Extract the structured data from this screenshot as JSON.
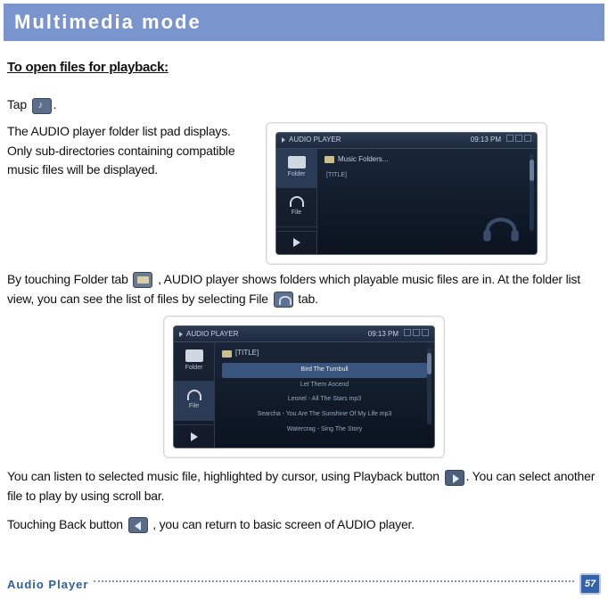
{
  "header": {
    "title": "Multimedia mode"
  },
  "subheading": "To open files for playback:",
  "tap_pre": "Tap ",
  "tap_post": ".",
  "folderlist_intro": "The AUDIO player folder list pad displays. Only sub-directories containing compatible music files will be displayed.",
  "by_touching_pre": "By touching Folder tab ",
  "by_touching_mid": " , AUDIO player shows folders which playable music files are in. At the folder list view, you can see the list of files by selecting File  ",
  "by_touching_post": " tab.",
  "listen_pre": "You can listen to selected music file, highlighted by cursor, using Playback button  ",
  "listen_post": ". You can select another file to play by using scroll bar.",
  "back_pre": "Touching Back button  ",
  "back_post": " , you can return to basic screen of AUDIO player.",
  "icons": {
    "music": "music-icon",
    "folder": "folder-icon",
    "headphones": "headphones-icon",
    "play": "play-icon",
    "back": "back-icon"
  },
  "shot1": {
    "app_label": "AUDIO PLAYER",
    "time": "09:13 PM",
    "tabs": {
      "folder": "Folder",
      "file": "File"
    },
    "heading": "Music Folders...",
    "line1": "[TITLE]"
  },
  "shot2": {
    "app_label": "AUDIO PLAYER",
    "time": "09:13 PM",
    "tabs": {
      "folder": "Folder",
      "file": "File"
    },
    "heading": "[TITLE]",
    "lines": [
      "Bird The Turnbull",
      "Let Them Ascend",
      "Leonel - All The Stars mp3",
      "Searcha - You Are The Sunshine Of My Life mp3",
      "Watercrag - Sing The Story"
    ]
  },
  "footer": {
    "label": "Audio Player",
    "page": "57"
  }
}
